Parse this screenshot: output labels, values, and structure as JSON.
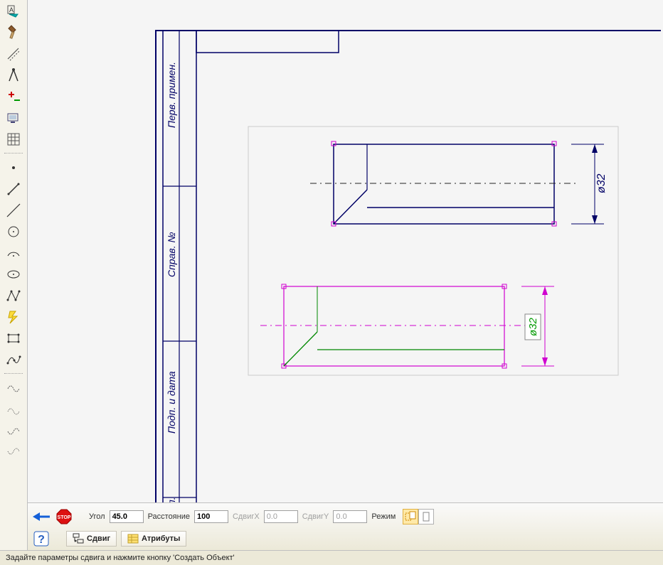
{
  "titleblock": {
    "block1": "Перв. примен.",
    "block2": "Справ. №",
    "block3": "Подп. и дата",
    "block4": "убл."
  },
  "dim_label_top": "ø32",
  "dim_label_bottom": "ø32",
  "panel": {
    "angle_label": "Угол",
    "angle_value": "45.0",
    "distance_label": "Расстояние",
    "distance_value": "100",
    "shiftx_label": "СдвигX",
    "shiftx_value": "0.0",
    "shifty_label": "СдвигY",
    "shifty_value": "0.0",
    "mode_label": "Режим"
  },
  "tabs": {
    "shift": "Сдвиг",
    "attrs": "Атрибуты"
  },
  "status": "Задайте параметры сдвига и нажмите кнопку 'Создать Объект'"
}
